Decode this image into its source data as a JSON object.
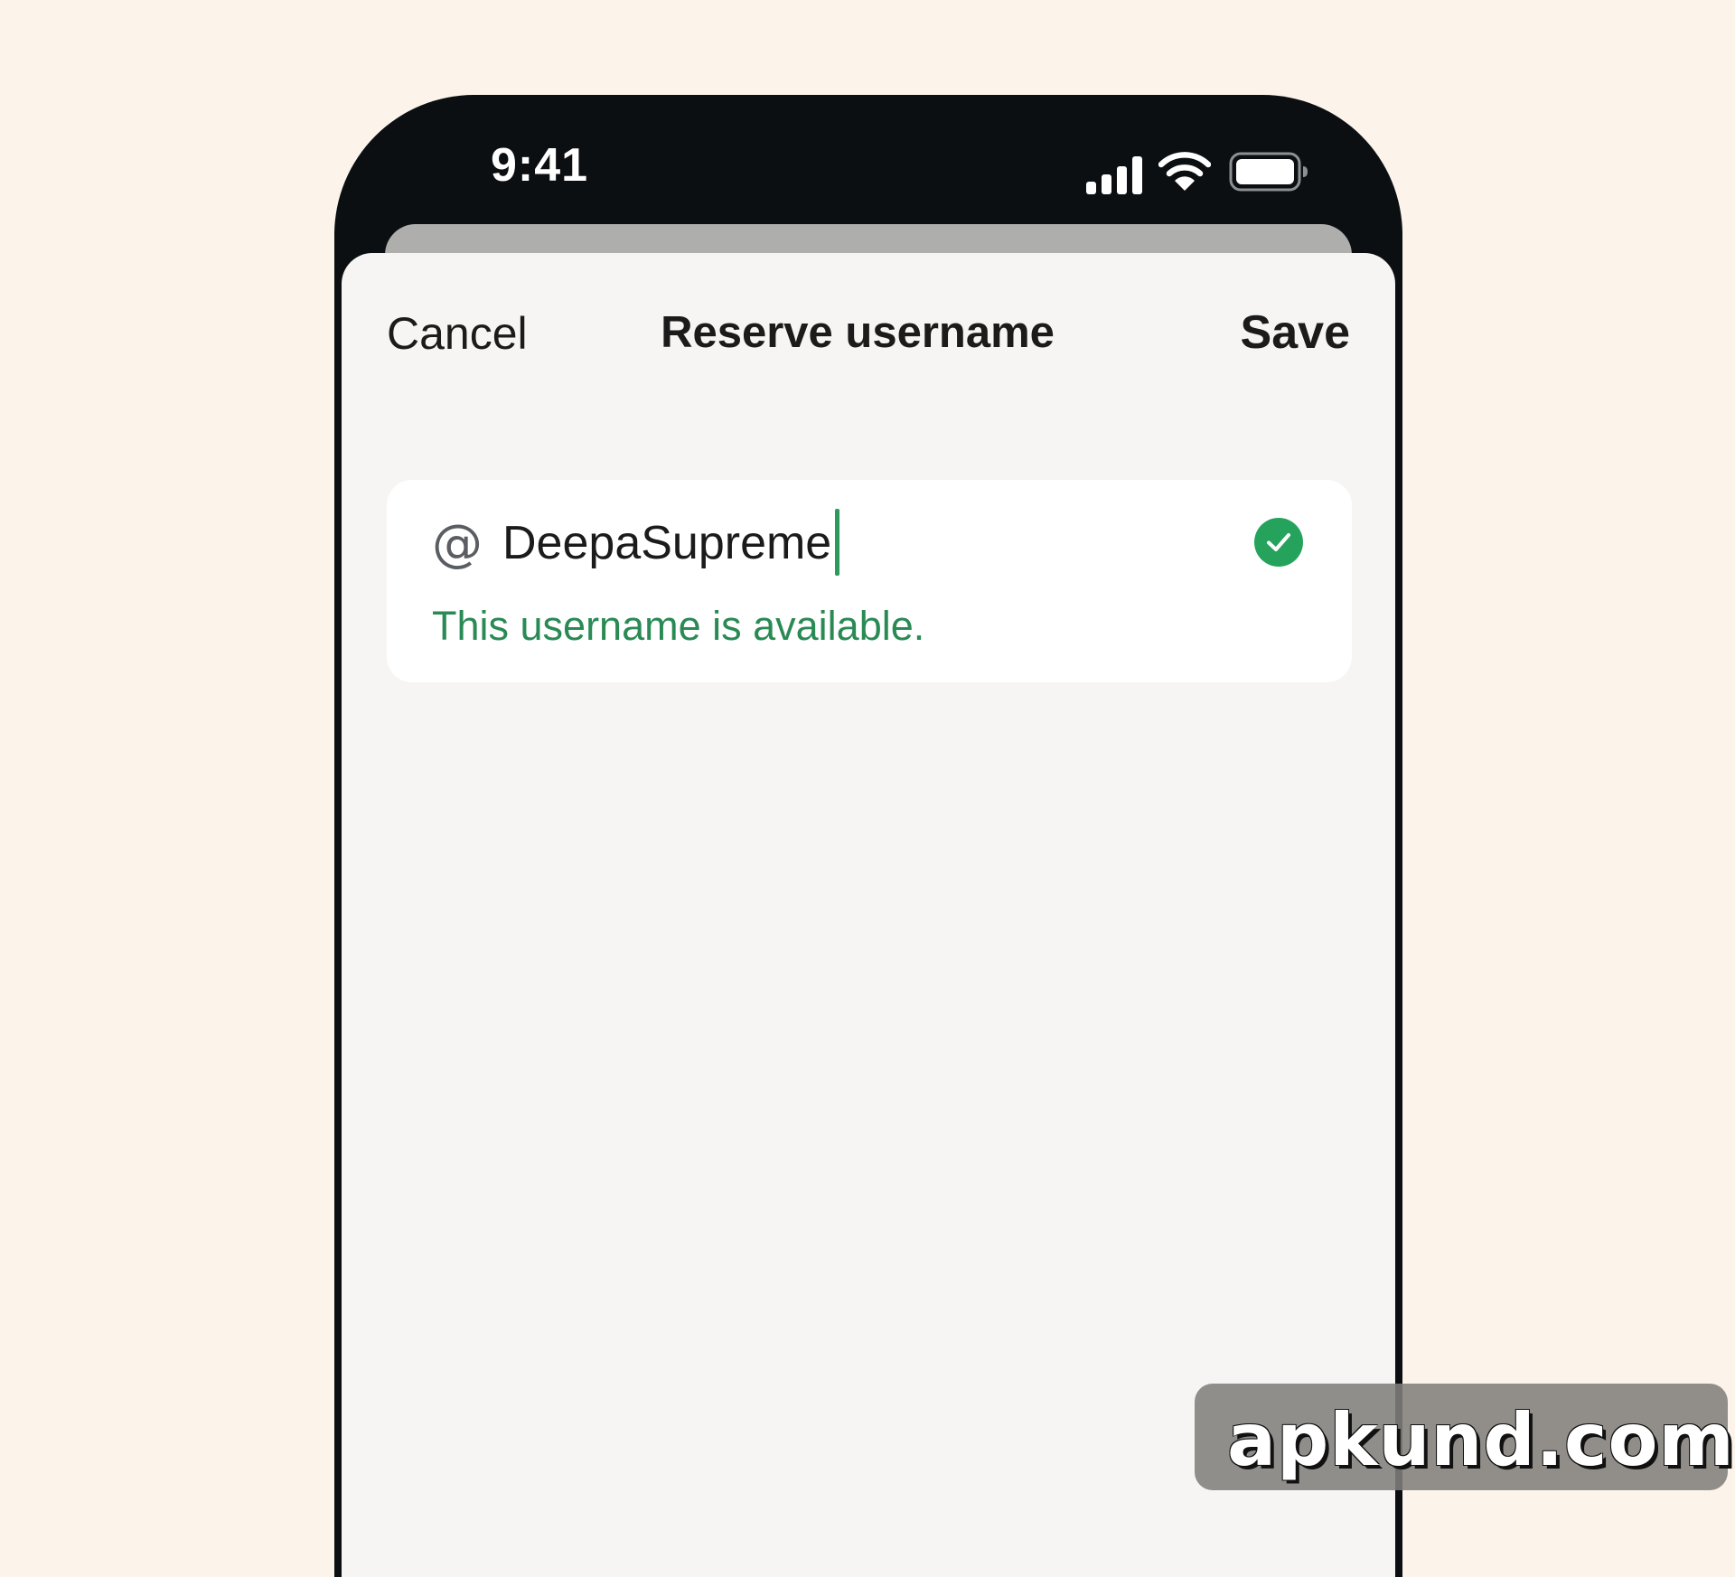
{
  "status_bar": {
    "time": "9:41",
    "icons": [
      "cellular-signal-icon",
      "wifi-icon",
      "battery-icon"
    ]
  },
  "nav": {
    "cancel_label": "Cancel",
    "title": "Reserve username",
    "save_label": "Save"
  },
  "username_field": {
    "prefix": "@",
    "value": "DeepaSupreme",
    "status_icon": "checkmark-circle-icon",
    "message": "This username is available."
  },
  "watermark": {
    "text": "apkund.com"
  },
  "colors": {
    "page_background": "#fcf4ea",
    "phone_frame": "#0b0f12",
    "sheet_background": "#f6f5f3",
    "card_background": "#ffffff",
    "success_green": "#2a8a54",
    "check_green": "#25a35c",
    "text_primary": "#1b1b1b"
  }
}
